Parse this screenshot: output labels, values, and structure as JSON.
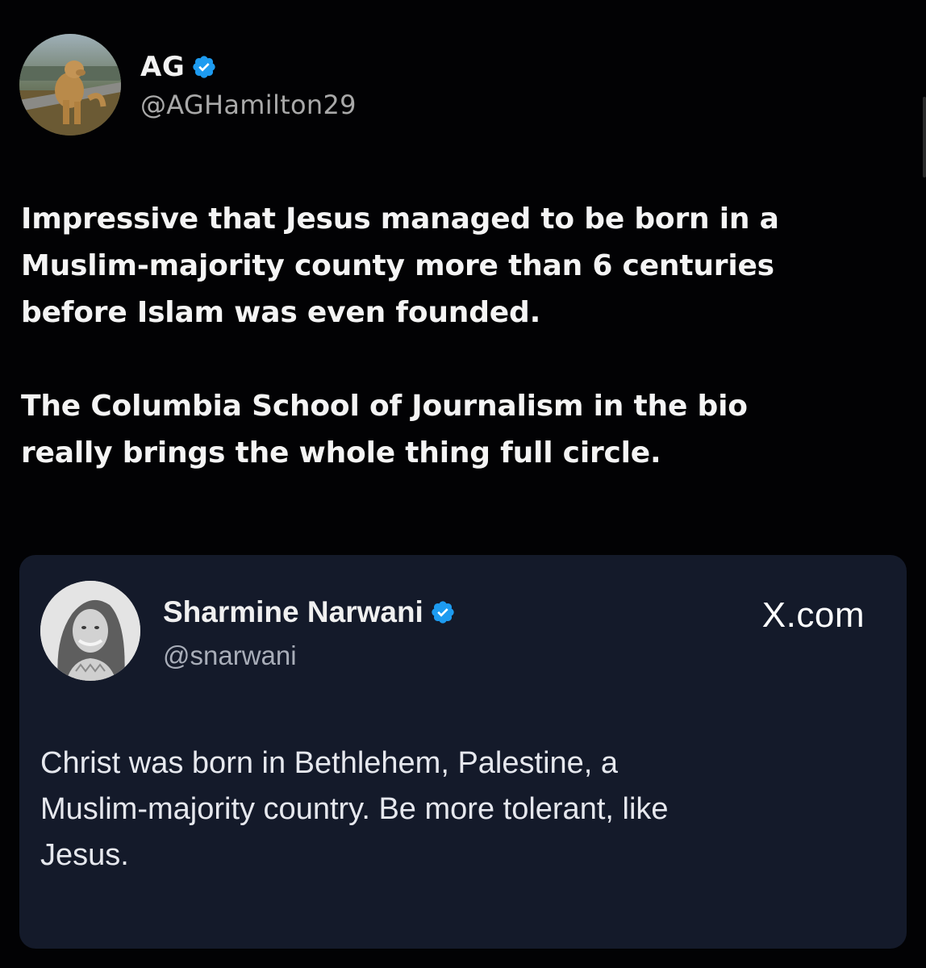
{
  "post": {
    "author_name": "AG",
    "author_handle": "@AGHamilton29",
    "avatar_icon": "dog-photo-avatar",
    "verified_icon": "verified-badge-icon",
    "paragraphs": [
      "Impressive that Jesus managed to be born in a\nMuslim-majority county more than 6 centuries\nbefore Islam was even founded.",
      "The Columbia School of Journalism in the bio\nreally brings the whole thing full circle."
    ]
  },
  "quoted_post": {
    "author_name": "Sharmine Narwani",
    "author_handle": "@snarwani",
    "avatar_icon": "portrait-photo-avatar",
    "source": "X.com",
    "text": "Christ was born in Bethlehem, Palestine, a\nMuslim-majority country. Be more tolerant, like\nJesus."
  },
  "colors": {
    "background": "#020204",
    "card_background": "#141a2a",
    "verified_blue": "#1d9bf0",
    "handle_gray": "#a9a9a9"
  }
}
